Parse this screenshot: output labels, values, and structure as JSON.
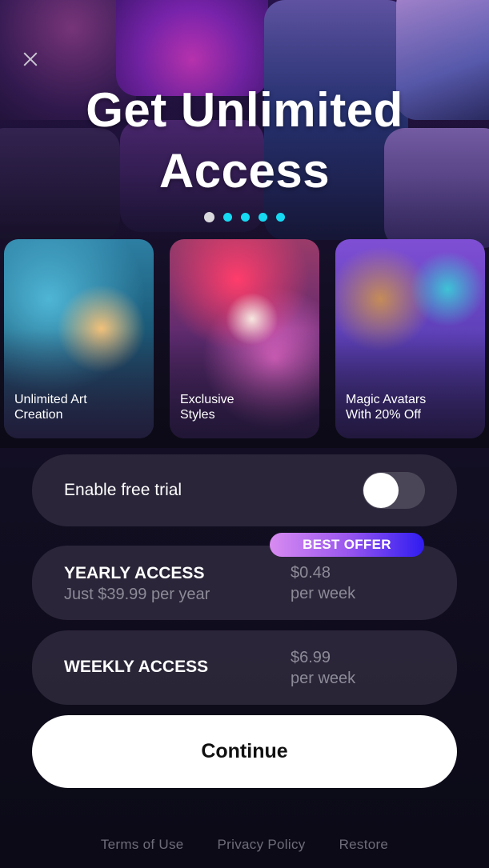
{
  "header": {
    "title": "Get Unlimited Access"
  },
  "carousel": {
    "active_index": 0,
    "dot_count": 5
  },
  "features": [
    {
      "label": "Unlimited Art\nCreation"
    },
    {
      "label": "Exclusive\nStyles"
    },
    {
      "label": "Magic Avatars\nWith 20% Off"
    }
  ],
  "trial": {
    "label": "Enable free trial",
    "enabled": false
  },
  "plans": {
    "badge": "BEST OFFER",
    "yearly": {
      "name": "YEARLY ACCESS",
      "subtitle": "Just $39.99 per year",
      "price": "$0.48",
      "period": "per week"
    },
    "weekly": {
      "name": "WEEKLY ACCESS",
      "price": "$6.99",
      "period": "per week"
    }
  },
  "cta": {
    "label": "Continue"
  },
  "footer": {
    "terms": "Terms of Use",
    "privacy": "Privacy Policy",
    "restore": "Restore"
  },
  "colors": {
    "dot_active": "#d9d9dd",
    "dot_inactive": "#16d9f2",
    "badge_gradient_start": "#d88bf0",
    "badge_gradient_end": "#2f1cf0"
  }
}
